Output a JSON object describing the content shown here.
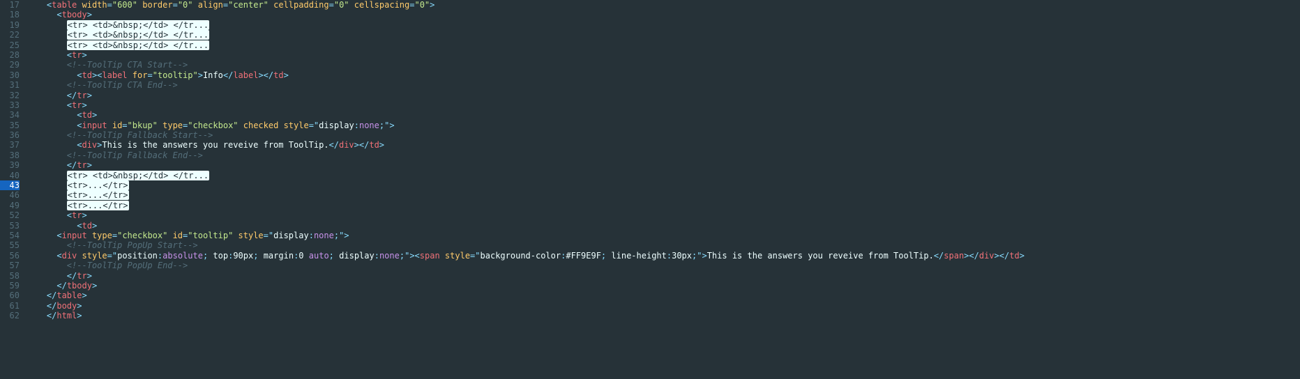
{
  "lineNumbers": [
    "17",
    "18",
    "19",
    "22",
    "25",
    "28",
    "29",
    "30",
    "31",
    "32",
    "33",
    "34",
    "35",
    "36",
    "37",
    "38",
    "39",
    "40",
    "43",
    "46",
    "49",
    "52",
    "53",
    "54",
    "55",
    "56",
    "57",
    "58",
    "59",
    "60",
    "61",
    "62"
  ],
  "activeLine": "43",
  "code": {
    "l17": {
      "indent": 2,
      "tag": "table",
      "attrs": [
        [
          "width",
          "600"
        ],
        [
          "border",
          "0"
        ],
        [
          "align",
          "center"
        ],
        [
          "cellpadding",
          "0"
        ],
        [
          "cellspacing",
          "0"
        ]
      ]
    },
    "l18": {
      "indent": 3,
      "tag": "tbody"
    },
    "l19": {
      "indent": 4,
      "folded": "<tr> <td>&nbsp;</td> </tr..."
    },
    "l22": {
      "indent": 4,
      "folded": "<tr> <td>&nbsp;</td> </tr..."
    },
    "l25": {
      "indent": 4,
      "folded": "<tr> <td>&nbsp;</td> </tr..."
    },
    "l28": {
      "indent": 4,
      "tag": "tr"
    },
    "l29": {
      "indent": 4,
      "comment": "<!--ToolTip CTA Start-->"
    },
    "l30": {
      "indent": 5,
      "labelFor": "tooltip",
      "labelText": "Info"
    },
    "l31": {
      "indent": 4,
      "comment": "<!--ToolTip CTA End-->"
    },
    "l32": {
      "indent": 4,
      "close": "tr"
    },
    "l33": {
      "indent": 4,
      "tag": "tr"
    },
    "l34": {
      "indent": 5,
      "tag": "td"
    },
    "l35": {
      "indent": 5,
      "input": {
        "id": "bkup",
        "type": "checkbox",
        "checked": true,
        "style": "display:none;"
      }
    },
    "l36": {
      "indent": 4,
      "comment": "<!--ToolTip Fallback Start-->"
    },
    "l37": {
      "indent": 5,
      "divText": "This is the answers you reveive from ToolTip."
    },
    "l38": {
      "indent": 4,
      "comment": "<!--ToolTip Fallback End-->"
    },
    "l39": {
      "indent": 4,
      "close": "tr"
    },
    "l40": {
      "indent": 4,
      "folded": "<tr> <td>&nbsp;</td> </tr..."
    },
    "l43": {
      "indent": 4,
      "folded": "<tr>...</tr>"
    },
    "l46": {
      "indent": 4,
      "folded": "<tr>...</tr>"
    },
    "l49": {
      "indent": 4,
      "folded": "<tr>...</tr>"
    },
    "l52": {
      "indent": 4,
      "tag": "tr"
    },
    "l53": {
      "indent": 5,
      "tag": "td"
    },
    "l54": {
      "indent": 3,
      "input2": {
        "type": "checkbox",
        "id": "tooltip",
        "style": "display:none;"
      }
    },
    "l55": {
      "indent": 4,
      "comment": "<!--ToolTip PopUp Start-->"
    },
    "l56": {
      "indent": 3,
      "popup": {
        "divStyle": "position:absolute; top:90px; margin:0 auto; display:none;",
        "spanStyle": "background-color:#FF9E9F; line-height:30px;",
        "text": "This is the answers you reveive from ToolTip."
      }
    },
    "l57": {
      "indent": 4,
      "comment": "<!--ToolTip PopUp End-->"
    },
    "l58": {
      "indent": 4,
      "close": "tr"
    },
    "l59": {
      "indent": 3,
      "close": "tbody"
    },
    "l60": {
      "indent": 2,
      "close": "table"
    },
    "l61": {
      "indent": 2,
      "close": "body"
    },
    "l62": {
      "indent": 2,
      "close": "html"
    }
  }
}
